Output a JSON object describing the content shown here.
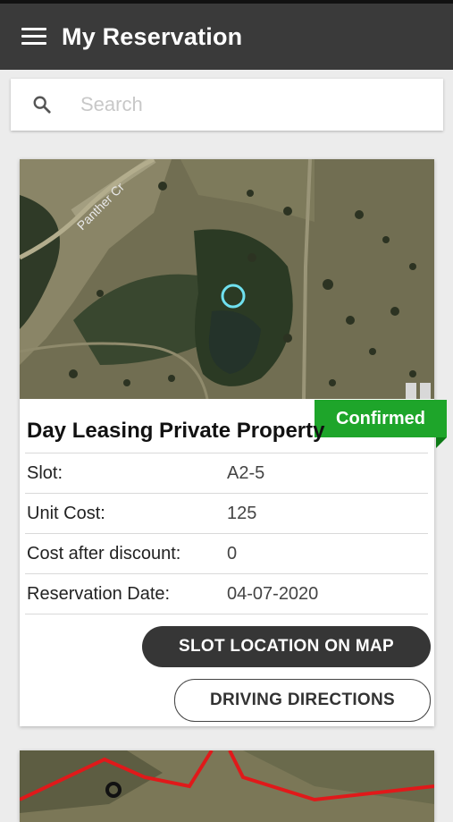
{
  "app_bar": {
    "title": "My Reservation",
    "menu_icon": "menu-icon"
  },
  "search": {
    "placeholder": "Search",
    "value": "",
    "icon": "search-icon"
  },
  "reservations": [
    {
      "status": "Confirmed",
      "status_color": "#1ea52a",
      "title": "Day Leasing Private Property",
      "map_label": "Panther Cr",
      "fields": [
        {
          "label": "Slot:",
          "value": "A2-5"
        },
        {
          "label": "Unit Cost:",
          "value": "125"
        },
        {
          "label": "Cost after discount:",
          "value": "0"
        },
        {
          "label": "Reservation Date:",
          "value": "04-07-2020"
        }
      ],
      "actions": {
        "slot_location": "SLOT LOCATION ON MAP",
        "driving_directions": "DRIVING DIRECTIONS"
      }
    }
  ],
  "colors": {
    "app_bar": "#3a3a3a",
    "badge": "#1ea52a",
    "primary_button": "#363636"
  }
}
